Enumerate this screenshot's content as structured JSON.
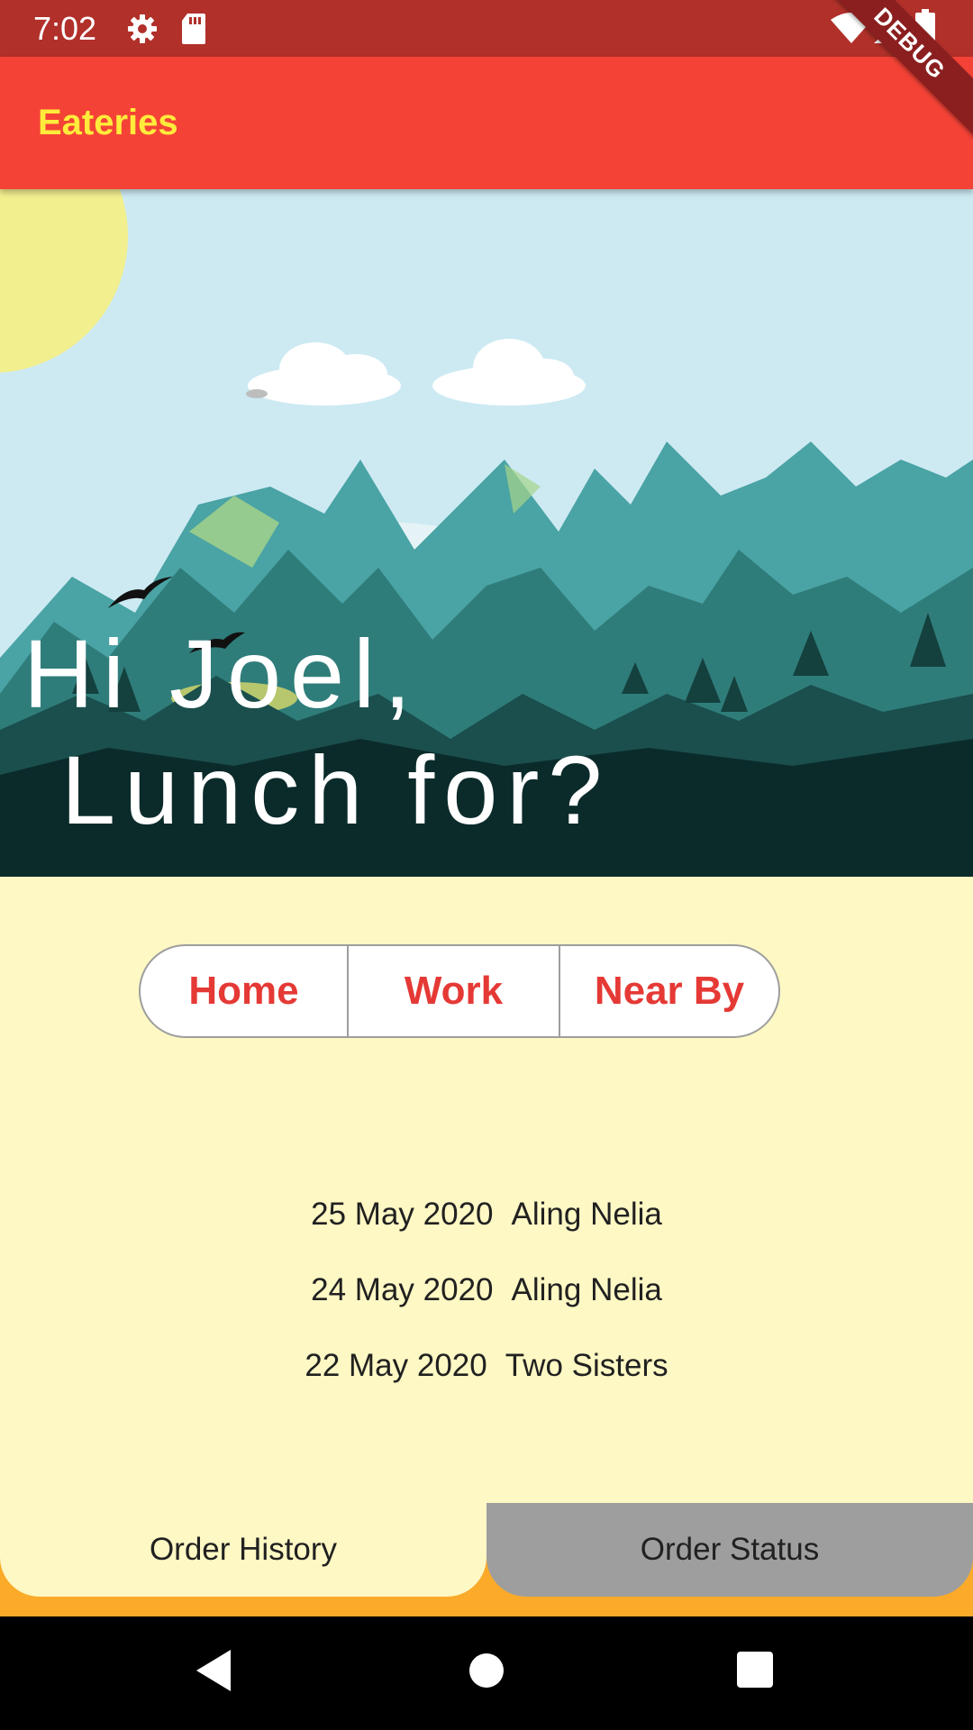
{
  "status_bar": {
    "time": "7:02",
    "icons": [
      "gear-icon",
      "sd-card-icon",
      "wifi-icon",
      "signal-icon",
      "battery-icon"
    ],
    "background": "#b1302a"
  },
  "debug_banner": "DEBUG",
  "app_bar": {
    "title": "Eateries",
    "background": "#f44336",
    "title_color": "#ffeb3b"
  },
  "hero": {
    "greeting_line1": "Hi Joel,",
    "greeting_line2": "Lunch for?",
    "illustration": "mountain-landscape"
  },
  "location_selector": {
    "options": [
      "Home",
      "Work",
      "Near By"
    ],
    "accent": "#e53935"
  },
  "order_history": [
    {
      "date": "25 May 2020",
      "restaurant": "Aling Nelia"
    },
    {
      "date": "24 May 2020",
      "restaurant": "Aling Nelia"
    },
    {
      "date": "22 May 2020",
      "restaurant": "Two Sisters"
    }
  ],
  "tabs": {
    "order_history": "Order History",
    "order_status": "Order Status",
    "selected": "Order History"
  },
  "nav_bar": {
    "icons": [
      "back-icon",
      "home-icon",
      "recents-icon"
    ]
  },
  "colors": {
    "page_background": "#fef8c4",
    "bottom_strip": "#fbaa2a",
    "inactive_tab": "#9e9e9e"
  }
}
